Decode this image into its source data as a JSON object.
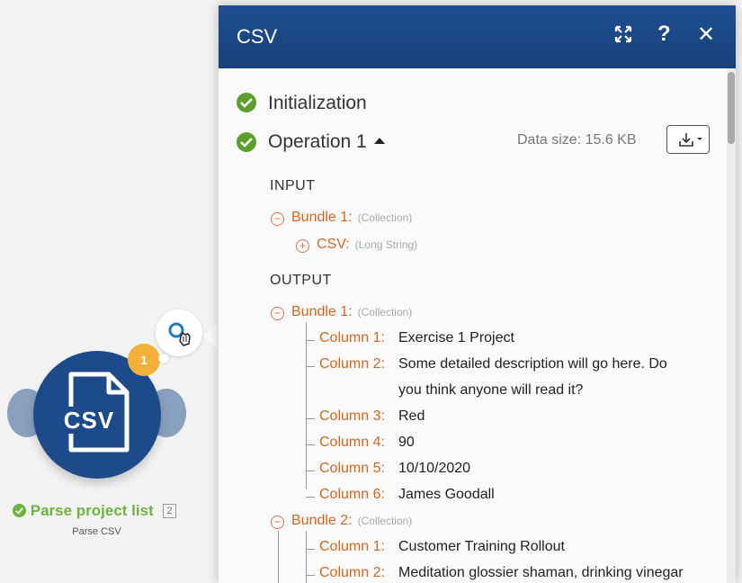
{
  "panel": {
    "title": "CSV",
    "expand_icon": "expand-icon",
    "help_label": "?",
    "close_label": "✕"
  },
  "status": {
    "initialization": "Initialization",
    "operation": "Operation 1",
    "data_size": "Data size: 15.6 KB"
  },
  "input": {
    "heading": "INPUT",
    "bundles": [
      {
        "label": "Bundle 1:",
        "type": "(Collection)",
        "children": [
          {
            "label": "CSV:",
            "type": "(Long String)"
          }
        ]
      }
    ]
  },
  "output": {
    "heading": "OUTPUT",
    "bundles": [
      {
        "label": "Bundle 1:",
        "type": "(Collection)",
        "fields": [
          {
            "key": "Column 1:",
            "value": "Exercise 1 Project"
          },
          {
            "key": "Column 2:",
            "value": "Some detailed description will go here. Do",
            "value_cont": "you think anyone will read it?"
          },
          {
            "key": "Column 3:",
            "value": "Red"
          },
          {
            "key": "Column 4:",
            "value": "90"
          },
          {
            "key": "Column 5:",
            "value": "10/10/2020"
          },
          {
            "key": "Column 6:",
            "value": "James Goodall"
          }
        ]
      },
      {
        "label": "Bundle 2:",
        "type": "(Collection)",
        "fields": [
          {
            "key": "Column 1:",
            "value": "Customer Training Rollout"
          },
          {
            "key": "Column 2:",
            "value": "Meditation glossier shaman, drinking vinegar"
          }
        ]
      }
    ]
  },
  "module": {
    "icon_label": "CSV",
    "badge": "1",
    "name": "Parse project list",
    "number": "2",
    "subtitle": "Parse CSV"
  },
  "colors": {
    "header": "#1d4a8a",
    "accent_orange": "#d4661f",
    "success_green": "#5aa02c",
    "badge_yellow": "#f2b136"
  }
}
